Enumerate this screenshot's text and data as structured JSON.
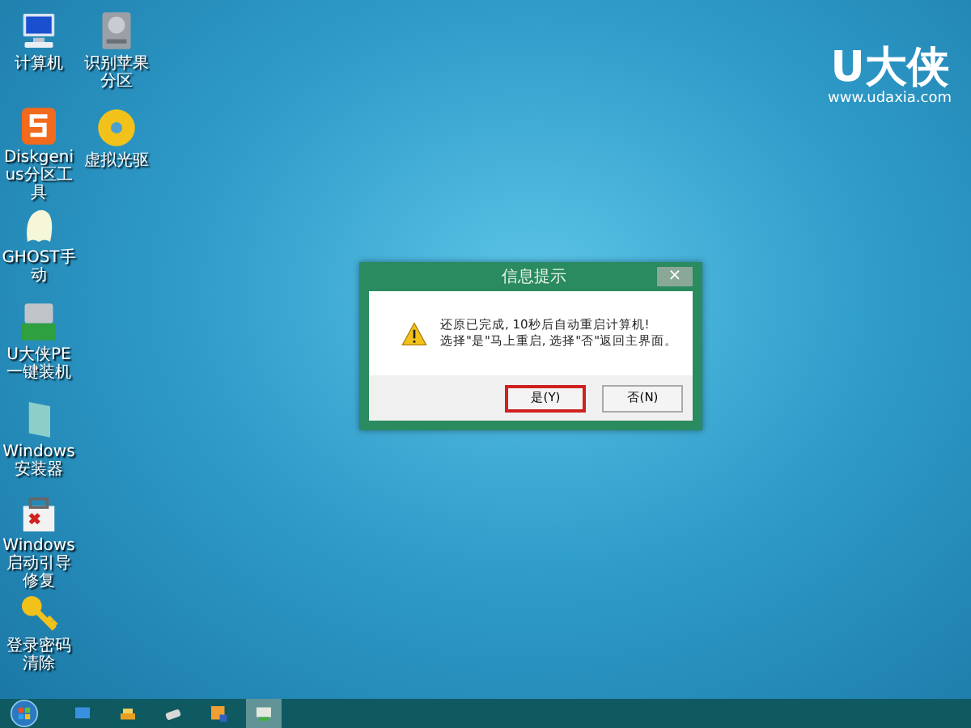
{
  "desktop_columns": [
    [
      {
        "kind": "computer",
        "label": "计算机"
      },
      {
        "kind": "partition",
        "label": "Diskgenius分区工具"
      },
      {
        "kind": "ghost",
        "label": "GHOST手动"
      },
      {
        "kind": "usb",
        "label": "U大侠PE一键装机"
      },
      {
        "kind": "installer",
        "label": "Windows安装器"
      },
      {
        "kind": "repair",
        "label": "Windows启动引导修复"
      },
      {
        "kind": "key",
        "label": "登录密码清除"
      }
    ],
    [
      {
        "kind": "drive",
        "label": "识别苹果分区"
      },
      {
        "kind": "disc",
        "label": "虚拟光驱"
      }
    ]
  ],
  "logo": {
    "brand": "U大侠",
    "url": "www.udaxia.com"
  },
  "dialog": {
    "title": "信息提示",
    "close": "×",
    "message_lines": [
      "还原已完成, 10秒后自动重启计算机!",
      "选择\"是\"马上重启, 选择\"否\"返回主界面。"
    ],
    "buttons": [
      {
        "label": "是(Y)",
        "selected": true
      },
      {
        "label": "否(N)",
        "selected": false
      }
    ]
  },
  "taskbar": {
    "items": [
      {
        "kind": "monitor",
        "selected": false
      },
      {
        "kind": "tools",
        "selected": false
      },
      {
        "kind": "drive",
        "selected": false
      },
      {
        "kind": "picture",
        "selected": false
      },
      {
        "kind": "screen",
        "selected": true
      }
    ]
  }
}
